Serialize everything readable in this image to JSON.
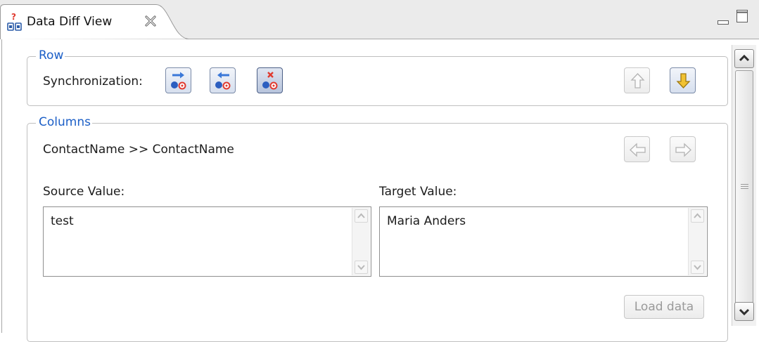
{
  "tab": {
    "title": "Data Diff View",
    "icon": "data-diff-icon",
    "close_icon": "close-tab-icon"
  },
  "window_controls": {
    "minimize_icon": "minimize-icon",
    "maximize_icon": "maximize-icon"
  },
  "row": {
    "legend": "Row",
    "sync_label": "Synchronization:",
    "sync_buttons": [
      {
        "icon": "copy-to-target-icon",
        "selected": false
      },
      {
        "icon": "copy-to-source-icon",
        "selected": false
      },
      {
        "icon": "ignore-difference-icon",
        "selected": true
      }
    ],
    "nav": {
      "previous_row_icon": "arrow-up-icon",
      "next_row_icon": "arrow-down-icon"
    }
  },
  "columns": {
    "legend": "Columns",
    "mapping": "ContactName >> ContactName",
    "nav": {
      "previous_column_icon": "arrow-left-icon",
      "next_column_icon": "arrow-right-icon"
    },
    "source_label": "Source Value:",
    "source_value": "test",
    "target_label": "Target Value:",
    "target_value": "Maria Anders",
    "load_button": "Load data"
  },
  "colors": {
    "legend": "#1c5fc7",
    "arrow_blue": "#3a78d8",
    "arrow_yellow": "#f1c232",
    "red": "#e03a2f"
  }
}
